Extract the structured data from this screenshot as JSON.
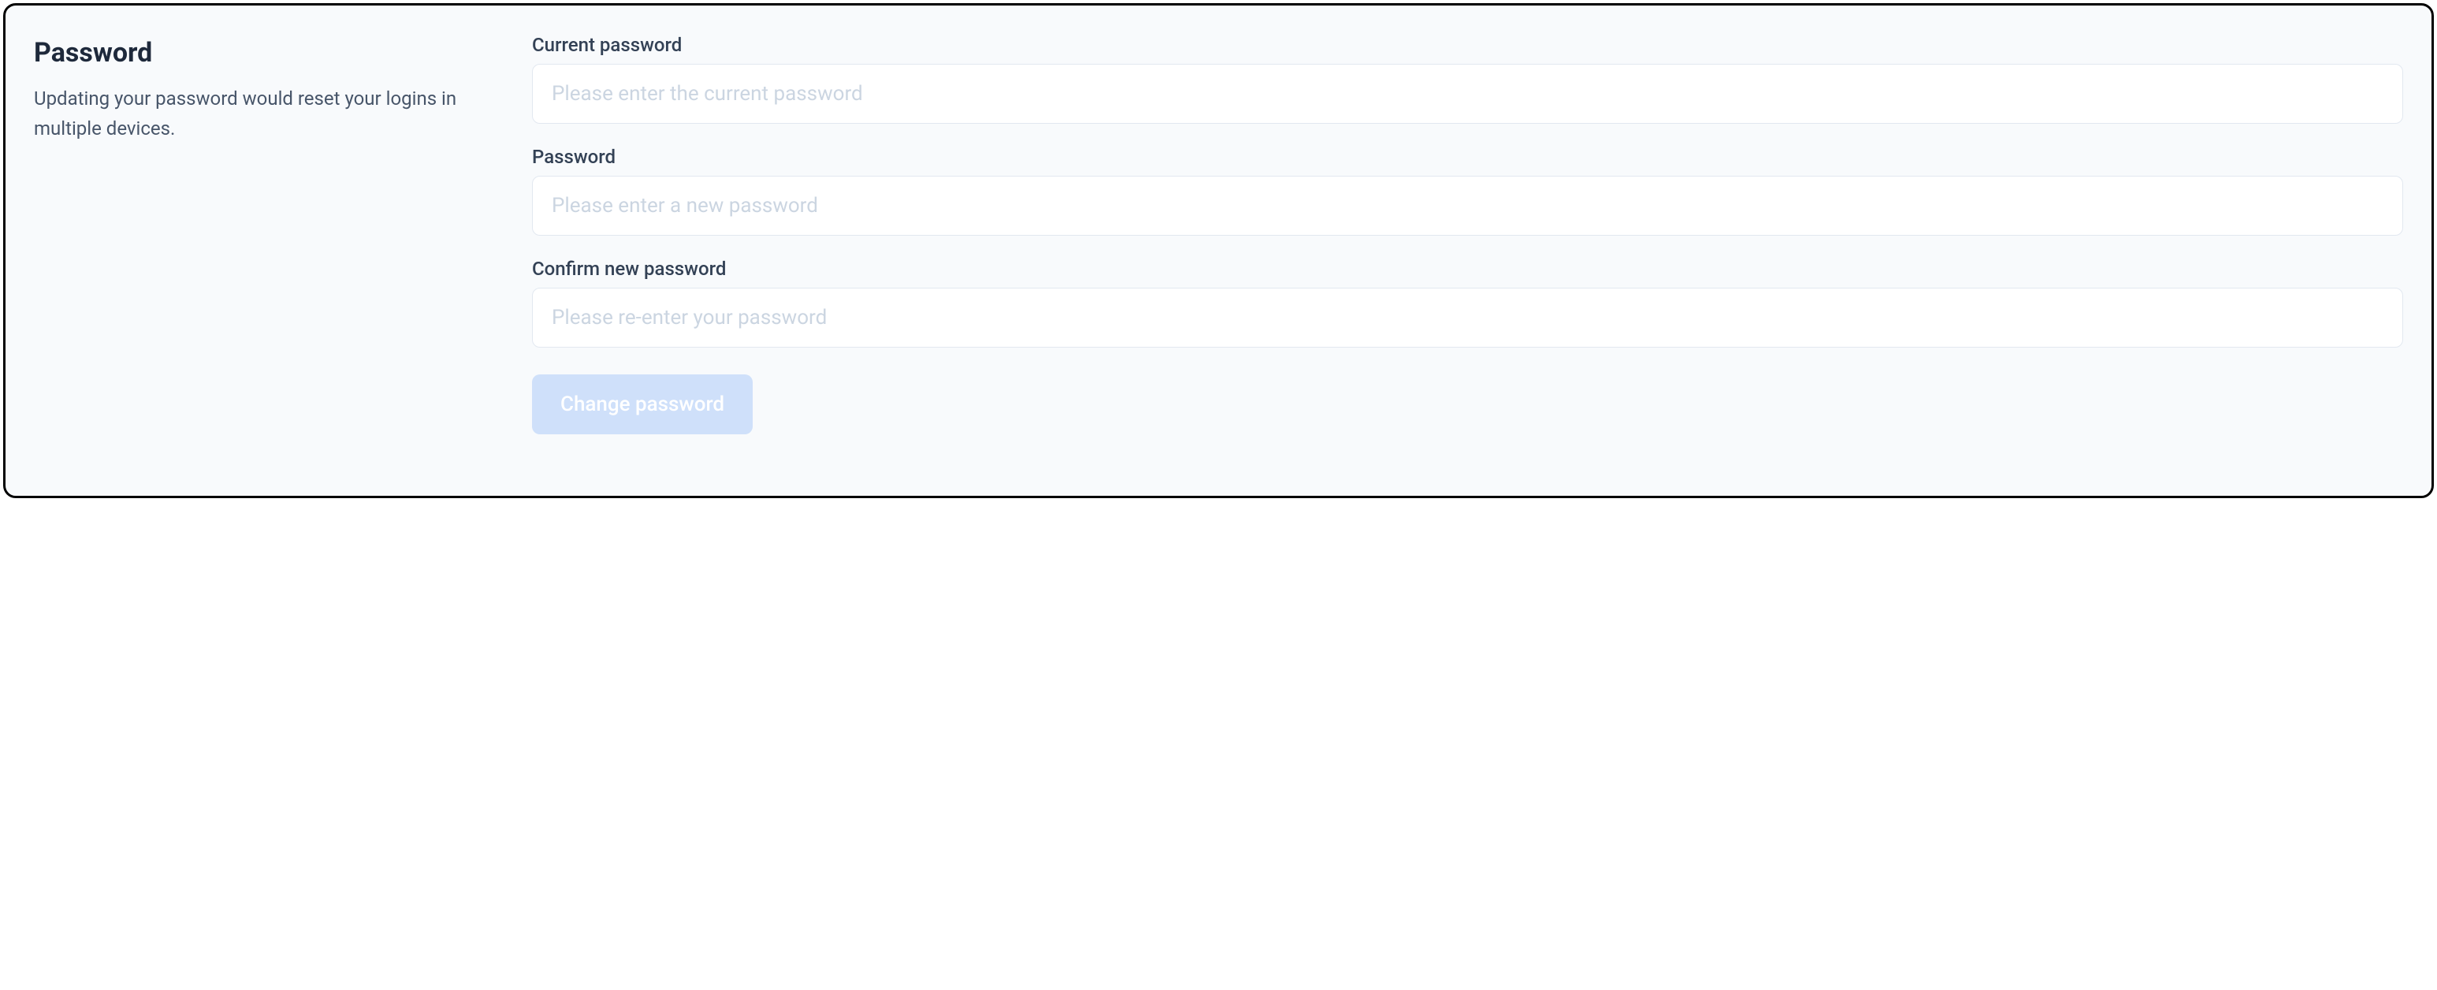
{
  "section": {
    "title": "Password",
    "description": "Updating your password would reset your logins in multiple devices."
  },
  "fields": {
    "current": {
      "label": "Current password",
      "placeholder": "Please enter the current password",
      "value": ""
    },
    "new": {
      "label": "Password",
      "placeholder": "Please enter a new password",
      "value": ""
    },
    "confirm": {
      "label": "Confirm new password",
      "placeholder": "Please re-enter your password",
      "value": ""
    }
  },
  "submit": {
    "label": "Change password"
  }
}
